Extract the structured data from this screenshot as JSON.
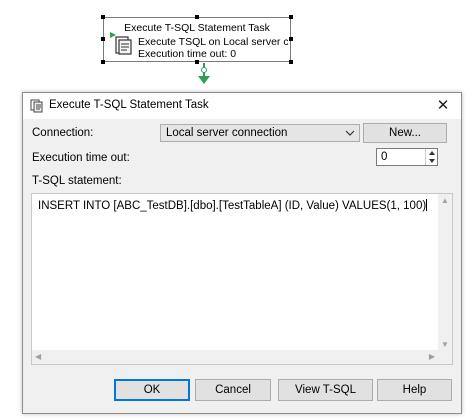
{
  "designer": {
    "task_title": "Execute T-SQL Statement Task",
    "task_line1": "Execute TSQL on Local server cor",
    "task_line2": "Execution time out: 0",
    "connector_color": "#2e9e5a"
  },
  "dialog": {
    "title": "Execute T-SQL Statement Task",
    "close_glyph": "✕",
    "connection_label": "Connection:",
    "connection_value": "Local server connection",
    "new_button": "New...",
    "timeout_label": "Execution time out:",
    "timeout_value": "0",
    "statement_label": "T-SQL statement:",
    "statement_text": "INSERT INTO [ABC_TestDB].[dbo].[TestTableA] (ID, Value) VALUES(1, 100)",
    "buttons": {
      "ok": "OK",
      "cancel": "Cancel",
      "view_tsql": "View T-SQL",
      "help": "Help"
    },
    "accent_color": "#0078d7"
  }
}
